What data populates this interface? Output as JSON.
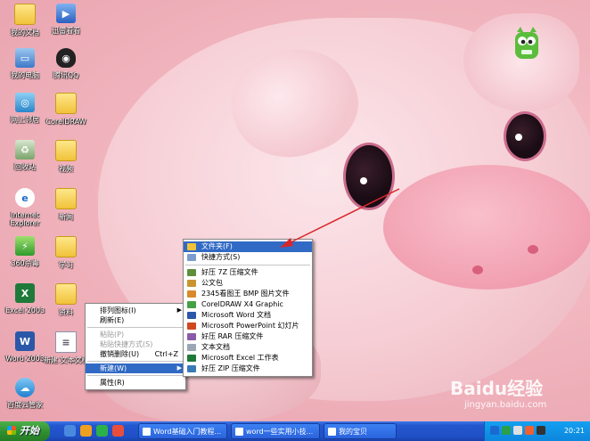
{
  "desktop_icons": [
    {
      "label": "我的文档",
      "icon": "folder-icon"
    },
    {
      "label": "我的电脑",
      "icon": "computer-icon"
    },
    {
      "label": "网上邻居",
      "icon": "network-icon"
    },
    {
      "label": "回收站",
      "icon": "recycle-bin-icon"
    },
    {
      "label": "Internet Explorer",
      "icon": "ie-icon"
    },
    {
      "label": "360杀毒",
      "icon": "shield-icon"
    },
    {
      "label": "Excel 2003",
      "icon": "excel-icon"
    },
    {
      "label": "Word 2003",
      "icon": "word-icon"
    },
    {
      "label": "百度云管家",
      "icon": "baidu-cloud-icon"
    },
    {
      "label": "迅雷看看",
      "icon": "player-icon"
    },
    {
      "label": "腾讯QQ",
      "icon": "qq-icon"
    },
    {
      "label": "CorelDRAW",
      "icon": "folder-icon"
    },
    {
      "label": "视频",
      "icon": "folder-icon"
    },
    {
      "label": "新闻",
      "icon": "folder-icon"
    },
    {
      "label": "学习",
      "icon": "folder-icon"
    },
    {
      "label": "资料",
      "icon": "folder-icon"
    },
    {
      "label": "新建 文本文档",
      "icon": "text-doc-icon"
    }
  ],
  "context_menu": {
    "items": [
      {
        "label": "排列图标(I)",
        "submenu": true,
        "disabled": false
      },
      {
        "label": "刷新(E)",
        "disabled": false
      },
      {
        "separator": true
      },
      {
        "label": "粘贴(P)",
        "disabled": true
      },
      {
        "label": "粘贴快捷方式(S)",
        "disabled": true
      },
      {
        "label": "撤销删除(U)",
        "accel": "Ctrl+Z",
        "disabled": false
      },
      {
        "separator": true
      },
      {
        "label": "新建(W)",
        "submenu": true,
        "selected": true
      },
      {
        "separator": true
      },
      {
        "label": "属性(R)",
        "disabled": false
      }
    ]
  },
  "new_submenu": {
    "items": [
      {
        "label": "文件夹(F)",
        "selected": true,
        "icon": "folder-icon",
        "color": "#f0c23a"
      },
      {
        "label": "快捷方式(S)",
        "icon": "shortcut-icon",
        "color": "#7a9ccf"
      },
      {
        "separator": true
      },
      {
        "label": "好压 7Z 压缩文件",
        "icon": "archive-icon",
        "color": "#5f8f3a"
      },
      {
        "label": "公文包",
        "icon": "briefcase-icon",
        "color": "#c8952f"
      },
      {
        "label": "2345看图王 BMP 图片文件",
        "icon": "image-icon",
        "color": "#d98b2b"
      },
      {
        "label": "CorelDRAW X4 Graphic",
        "icon": "coreldraw-icon",
        "color": "#46a044"
      },
      {
        "label": "Microsoft Word 文档",
        "icon": "word-icon",
        "color": "#2b57a8"
      },
      {
        "label": "Microsoft PowerPoint 幻灯片",
        "icon": "powerpoint-icon",
        "color": "#d0461f"
      },
      {
        "label": "好压 RAR 压缩文件",
        "icon": "archive-icon",
        "color": "#8a5aa8"
      },
      {
        "label": "文本文档",
        "icon": "text-doc-icon",
        "color": "#9aa6b4"
      },
      {
        "label": "Microsoft Excel 工作表",
        "icon": "excel-icon",
        "color": "#1f7a3a"
      },
      {
        "label": "好压 ZIP 压缩文件",
        "icon": "archive-icon",
        "color": "#3a7ab8"
      }
    ]
  },
  "taskbar": {
    "start_label": "开始",
    "tasks": [
      {
        "label": "Word基础入门教程..."
      },
      {
        "label": "word一些实用小技..."
      },
      {
        "label": "我的宝贝"
      }
    ],
    "clock": "20:21"
  },
  "watermark": {
    "brand": "Baidu经验",
    "url": "jingyan.baidu.com"
  },
  "colors": {
    "selection": "#316ac5",
    "taskbar": "#2457cf",
    "start_button": "#2e8f2e",
    "arrow": "#d9262a"
  }
}
